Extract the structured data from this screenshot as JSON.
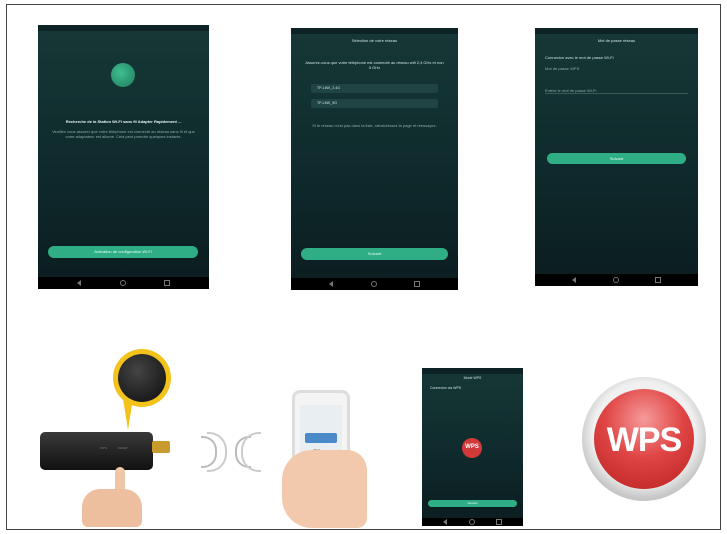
{
  "screen1": {
    "title": "Recherche de la Station Wi-Fi sans fil Adapter Rapidement ...",
    "body": "Veuillez vous assurer que votre téléphone est connecté au réseau sans fil et que votre adaptateur est allumé. Cela peut prendre quelques instants.",
    "button": "Activation de configuration Wi-Fi"
  },
  "screen2": {
    "header": "Sélection de votre réseau",
    "prompt": "Assurez-vous que votre téléphone est connecté au réseau wifi 2,4 GHz et non 5 GHz",
    "wifi1": "TP-LINK_2.4G",
    "wifi2": "TP-LINK_5G",
    "note": "Si le réseau n'est pas dans la liste, rafraîchissez la page et réessayez.",
    "button": "Suivant"
  },
  "screen3": {
    "header": "Mot de passe réseau",
    "option1": "Connexion avec le mot de passe Wi-Fi",
    "option2": "Mot de passe WPS",
    "field_placeholder": "Entrez le mot de passe Wi-Fi",
    "button": "Suivant"
  },
  "screen4": {
    "header": "Mode WPS",
    "option1": "Connexion via WPS",
    "center_label": "WPS",
    "button": "Suivant"
  },
  "logo": {
    "text": "WPS",
    "color": "#e04545"
  },
  "device": {
    "label1": "WPS",
    "label2": "RESET"
  },
  "handphone": {
    "button": "OK"
  }
}
